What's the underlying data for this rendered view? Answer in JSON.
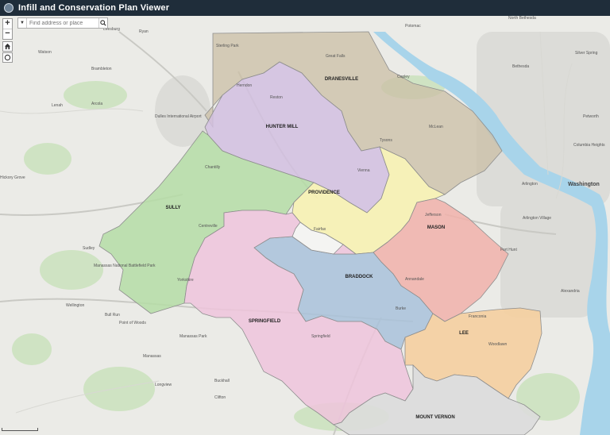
{
  "app": {
    "title": "Infill and Conservation Plan Viewer"
  },
  "search": {
    "placeholder": "Find address or place"
  },
  "controls": {
    "zoom_in": "+",
    "zoom_out": "−"
  },
  "districts": [
    {
      "name": "DRANESVILLE",
      "color": "#cbbfa6"
    },
    {
      "name": "HUNTER MILL",
      "color": "#d2bfe0"
    },
    {
      "name": "SULLY",
      "color": "#b5dda6"
    },
    {
      "name": "PROVIDENCE",
      "color": "#f7f2b3"
    },
    {
      "name": "MASON",
      "color": "#f1b1aa"
    },
    {
      "name": "BRADDOCK",
      "color": "#a9c2da"
    },
    {
      "name": "SPRINGFIELD",
      "color": "#efc4dc"
    },
    {
      "name": "LEE",
      "color": "#f5cfa0"
    },
    {
      "name": "MOUNT VERNON",
      "color": "#dcdcdc"
    }
  ],
  "places": [
    "Potomac",
    "North Bethesda",
    "Silver Spring",
    "Bethesda",
    "Great Falls",
    "Sterling Park",
    "Leesburg",
    "Brambleton",
    "Watson",
    "Arcola",
    "Lenah",
    "Dulles International Airport",
    "Herndon",
    "Reston",
    "Chantilly",
    "Centreville",
    "Vienna",
    "McLean",
    "Arlington",
    "Washington",
    "Arlington Village",
    "Alexandria",
    "Fairfax",
    "Fort Hunt",
    "Yorkshire",
    "Manassas Park",
    "Manassas",
    "Point of Woods",
    "Bull Run",
    "Wellington",
    "Sudley",
    "Manassas National Battlefield Park",
    "Hickory Grove",
    "Longview",
    "Buckhall",
    "Springfield",
    "Annandale",
    "Franconia",
    "Jefferson",
    "Columbia Heights",
    "Petworth",
    "Copley",
    "Ryan",
    "Tysons",
    "Burke",
    "Woodlawn",
    "Clifton"
  ]
}
